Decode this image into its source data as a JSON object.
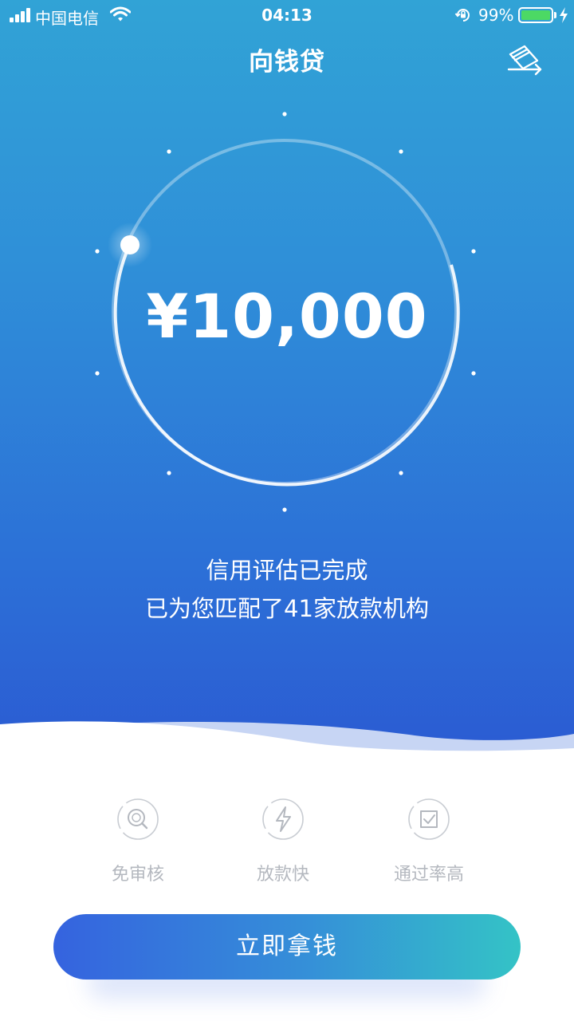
{
  "status_bar": {
    "carrier": "中国电信",
    "time": "04:13",
    "battery_percent": "99%",
    "battery_level": 0.99
  },
  "nav": {
    "title": "向钱贷",
    "right_icon": "card-icon"
  },
  "credit": {
    "amount": "¥10,000",
    "line1": "信用评估已完成",
    "line2": "已为您匹配了41家放款机构"
  },
  "features": [
    {
      "label": "免审核",
      "icon": "search-icon"
    },
    {
      "label": "放款快",
      "icon": "lightning-icon"
    },
    {
      "label": "通过率高",
      "icon": "check-badge-icon"
    }
  ],
  "cta": {
    "label": "立即拿钱"
  },
  "colors": {
    "hero_top": "#31a3d6",
    "hero_bottom": "#2b5ad2",
    "cta_start": "#3563df",
    "cta_end": "#34c3c6",
    "feature_text": "#b4b8bf",
    "battery_green": "#4cd964"
  }
}
